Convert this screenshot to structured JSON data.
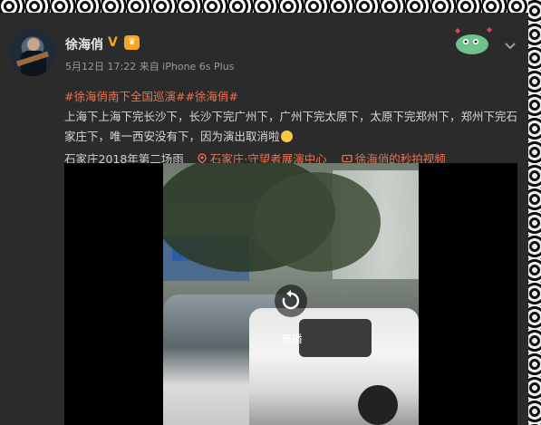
{
  "post": {
    "username": "徐海俏",
    "verified_mark": "V",
    "meta": "5月12日 17:22 来自 iPhone 6s Plus",
    "topic": "#徐海俏南下全国巡演##徐海俏#",
    "text": "上海下上海下完长沙下，长沙下完广州下，广州下完太原下，太原下完郑州下，郑州下完石家庄下，唯一西安没有下，因为演出取消啦",
    "footer_text": "石家庄2018年第二场雨",
    "location": "石家庄·守望者展演中心",
    "video_link": "徐海俏的秒拍视频"
  },
  "player": {
    "replay_label": "重播"
  },
  "icons": {
    "verified": "verified-icon",
    "badge": "member-badge-icon",
    "location": "location-pin-icon",
    "video": "video-icon",
    "replay": "replay-icon",
    "menu": "chevron-down-icon"
  },
  "colors": {
    "accent": "#eb7350",
    "verified": "#f5a623"
  }
}
